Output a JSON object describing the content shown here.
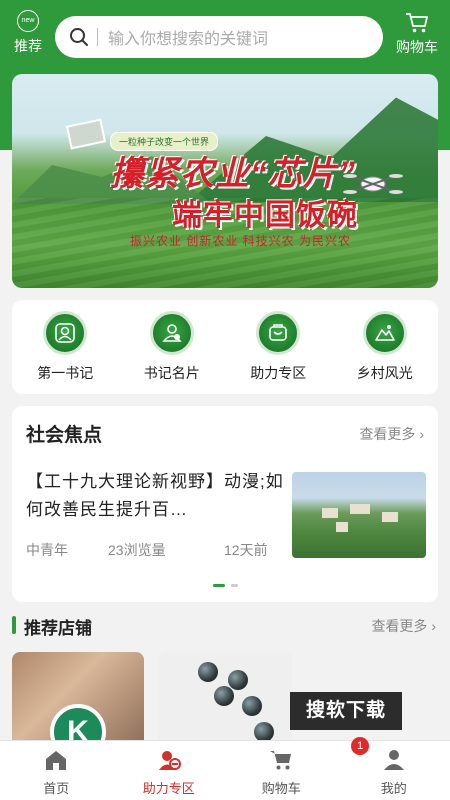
{
  "header": {
    "recommend_icon_text": "new",
    "recommend_label": "推荐",
    "search_placeholder": "输入你想搜索的关键词",
    "cart_label": "购物车"
  },
  "banner": {
    "tag": "一粒种子改变一个世界",
    "line1": "攥紧农业“芯片”",
    "line2": "端牢中国饭碗",
    "line3": "振兴农业  创新农业  科技兴农  为民兴农"
  },
  "quick_nav": [
    {
      "label": "第一书记",
      "icon": "person-badge-icon"
    },
    {
      "label": "书记名片",
      "icon": "person-card-icon"
    },
    {
      "label": "助力专区",
      "icon": "shop-icon"
    },
    {
      "label": "乡村风光",
      "icon": "mountain-icon"
    }
  ],
  "focus": {
    "title": "社会焦点",
    "more": "查看更多",
    "article": {
      "title": "【工十九大理论新视野】动漫;如何改善民生提升百…",
      "source": "中青年",
      "views": "23浏览量",
      "time": "12天前"
    }
  },
  "shops": {
    "title": "推荐店铺",
    "more": "查看更多",
    "logo_letter": "K",
    "download_badge": "搜软下载"
  },
  "tabs": [
    {
      "label": "首页",
      "icon": "home-icon"
    },
    {
      "label": "助力专区",
      "icon": "help-zone-icon"
    },
    {
      "label": "购物车",
      "icon": "cart-icon",
      "badge": "1"
    },
    {
      "label": "我的",
      "icon": "user-icon"
    }
  ],
  "colors": {
    "brand_green": "#2e9a3c",
    "active_tab": "#d0312d",
    "badge_red": "#e02b2b"
  }
}
